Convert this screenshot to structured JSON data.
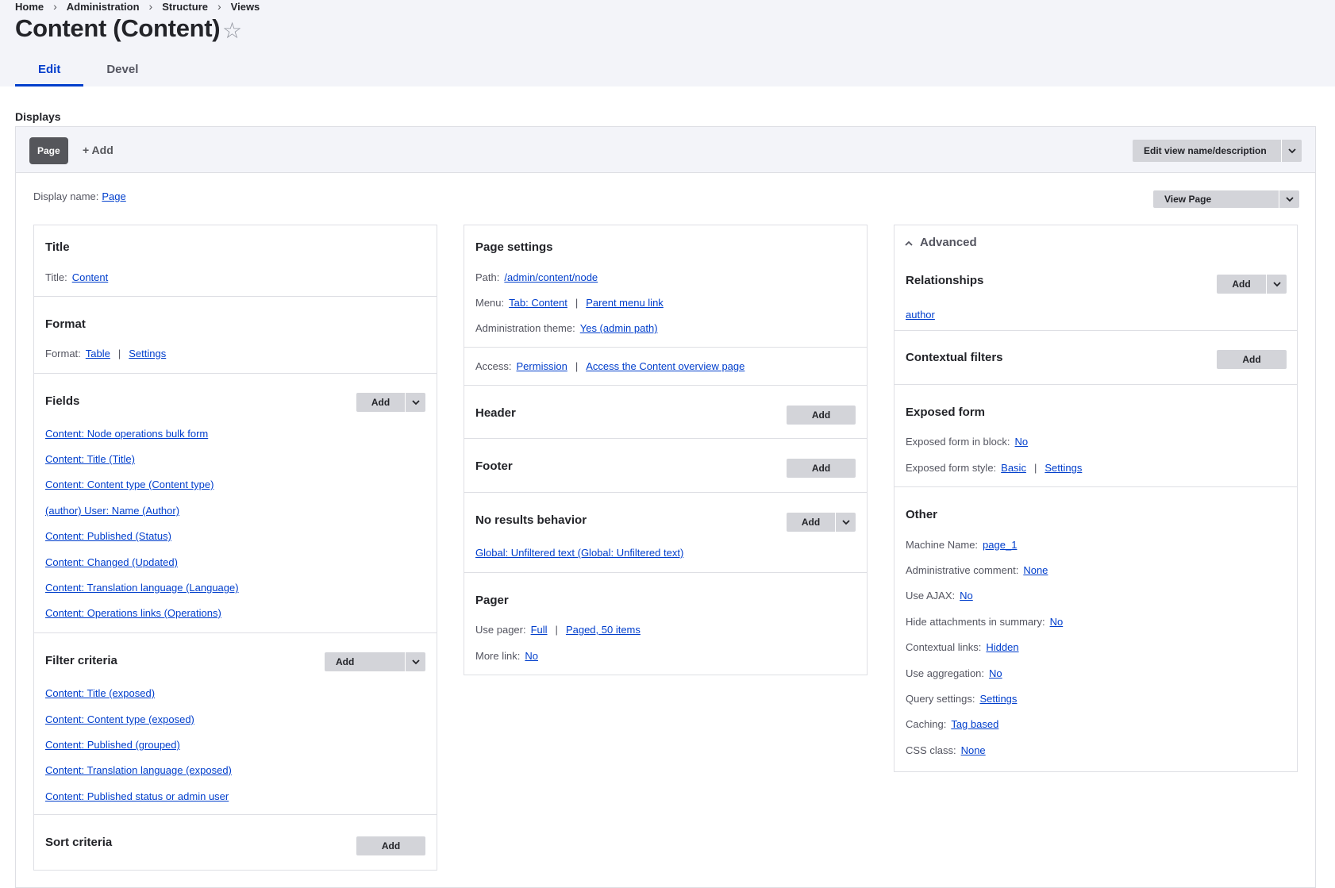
{
  "breadcrumb": [
    "Home",
    "Administration",
    "Structure",
    "Views"
  ],
  "page_title": "Content (Content)",
  "tabs": [
    "Edit",
    "Devel"
  ],
  "displays_label": "Displays",
  "display_tabs": {
    "page": "Page",
    "add": "+ Add"
  },
  "edit_view_button": "Edit view name/description",
  "display_name_label": "Display name:",
  "display_name_value": "Page",
  "view_page_button": "View Page",
  "col1": {
    "title": {
      "heading": "Title",
      "label": "Title:",
      "value": "Content"
    },
    "format": {
      "heading": "Format",
      "label": "Format:",
      "value1": "Table",
      "value2": "Settings"
    },
    "fields": {
      "heading": "Fields",
      "add": "Add",
      "items": [
        "Content: Node operations bulk form",
        "Content: Title (Title)",
        "Content: Content type (Content type)",
        "(author) User: Name (Author)",
        "Content: Published (Status)",
        "Content: Changed (Updated)",
        "Content: Translation language (Language)",
        "Content: Operations links (Operations)"
      ]
    },
    "filters": {
      "heading": "Filter criteria",
      "add": "Add",
      "items": [
        "Content: Title (exposed)",
        "Content: Content type (exposed)",
        "Content: Published (grouped)",
        "Content: Translation language (exposed)",
        "Content: Published status or admin user"
      ]
    },
    "sort": {
      "heading": "Sort criteria",
      "add": "Add"
    }
  },
  "col2": {
    "page_settings": {
      "heading": "Page settings",
      "path_label": "Path:",
      "path_value": "/admin/content/node",
      "menu_label": "Menu:",
      "menu_value1": "Tab: Content",
      "menu_value2": "Parent menu link",
      "theme_label": "Administration theme:",
      "theme_value": "Yes (admin path)"
    },
    "access": {
      "label": "Access:",
      "value1": "Permission",
      "value2": "Access the Content overview page"
    },
    "header": {
      "heading": "Header",
      "add": "Add"
    },
    "footer": {
      "heading": "Footer",
      "add": "Add"
    },
    "no_results": {
      "heading": "No results behavior",
      "add": "Add",
      "item": "Global: Unfiltered text (Global: Unfiltered text)"
    },
    "pager": {
      "heading": "Pager",
      "use_label": "Use pager:",
      "use_value1": "Full",
      "use_value2": "Paged, 50 items",
      "more_label": "More link:",
      "more_value": "No"
    }
  },
  "col3": {
    "advanced": "Advanced",
    "relationships": {
      "heading": "Relationships",
      "add": "Add",
      "item": "author"
    },
    "contextual": {
      "heading": "Contextual filters",
      "add": "Add"
    },
    "exposed": {
      "heading": "Exposed form",
      "block_label": "Exposed form in block:",
      "block_value": "No",
      "style_label": "Exposed form style:",
      "style_value1": "Basic",
      "style_value2": "Settings"
    },
    "other": {
      "heading": "Other",
      "rows": [
        {
          "label": "Machine Name:",
          "value": "page_1"
        },
        {
          "label": "Administrative comment:",
          "value": "None"
        },
        {
          "label": "Use AJAX:",
          "value": "No"
        },
        {
          "label": "Hide attachments in summary:",
          "value": "No"
        },
        {
          "label": "Contextual links:",
          "value": "Hidden"
        },
        {
          "label": "Use aggregation:",
          "value": "No"
        },
        {
          "label": "Query settings:",
          "value": "Settings"
        },
        {
          "label": "Caching:",
          "value": "Tag based"
        },
        {
          "label": "CSS class:",
          "value": "None"
        }
      ]
    }
  },
  "icons": {
    "star": "star-icon",
    "caret": "chevron-down-icon",
    "collapse": "chevron-up-icon"
  }
}
